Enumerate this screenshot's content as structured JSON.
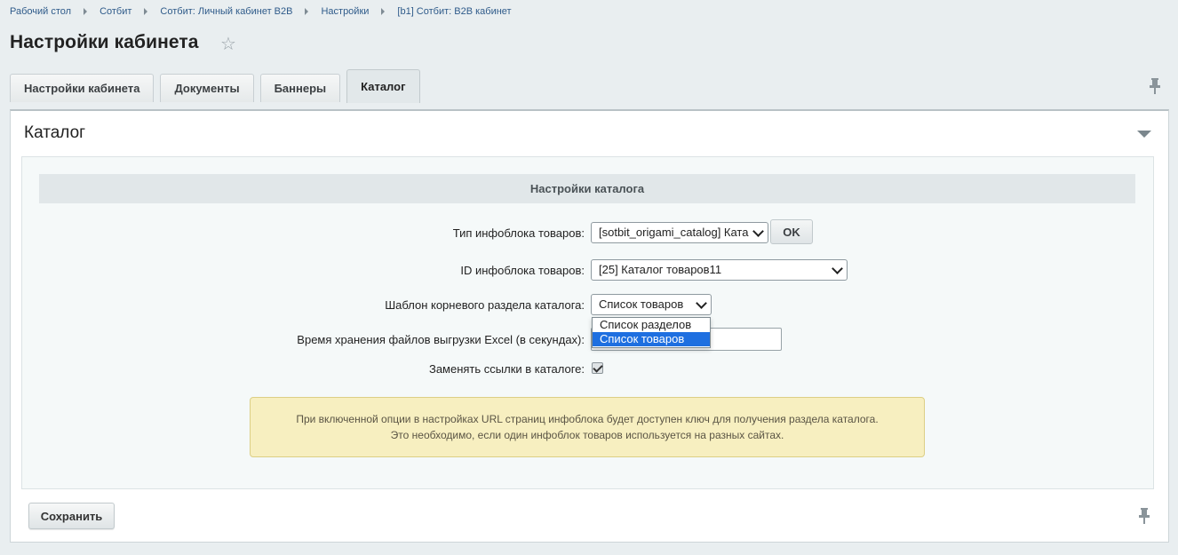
{
  "breadcrumb": [
    "Рабочий стол",
    "Сотбит",
    "Сотбит: Личный кабинет B2B",
    "Настройки",
    "[b1] Сотбит: B2B кабинет"
  ],
  "page": {
    "title": "Настройки кабинета"
  },
  "tabs": [
    "Настройки кабинета",
    "Документы",
    "Баннеры",
    "Каталог"
  ],
  "active_tab": "Каталог",
  "panel": {
    "title": "Каталог"
  },
  "section": {
    "title": "Настройки каталога"
  },
  "fields": {
    "iblock_type": {
      "label": "Тип инфоблока товаров:",
      "value": "[sotbit_origami_catalog] Ката",
      "ok_label": "OK"
    },
    "iblock_id": {
      "label": "ID инфоблока товаров:",
      "value": "[25] Каталог товаров11"
    },
    "root_template": {
      "label": "Шаблон корневого раздела каталога:",
      "value": "Список товаров",
      "options": [
        "Список разделов",
        "Список товаров"
      ],
      "selected": "Список товаров"
    },
    "excel_time": {
      "label": "Время хранения файлов выгрузки Excel (в секундах):",
      "value": ""
    },
    "replace_links": {
      "label": "Заменять ссылки в каталоге:",
      "checked": true
    }
  },
  "note": {
    "line1": "При включенной опции в настройках URL страниц инфоблока будет доступен ключ для получения раздела каталога.",
    "line2": "Это необходимо, если один инфоблок товаров используется на разных сайтах."
  },
  "save_label": "Сохранить",
  "icons": {
    "favorite": "star-icon",
    "pin": "pin-icon",
    "collapse": "triangle-down-icon"
  }
}
